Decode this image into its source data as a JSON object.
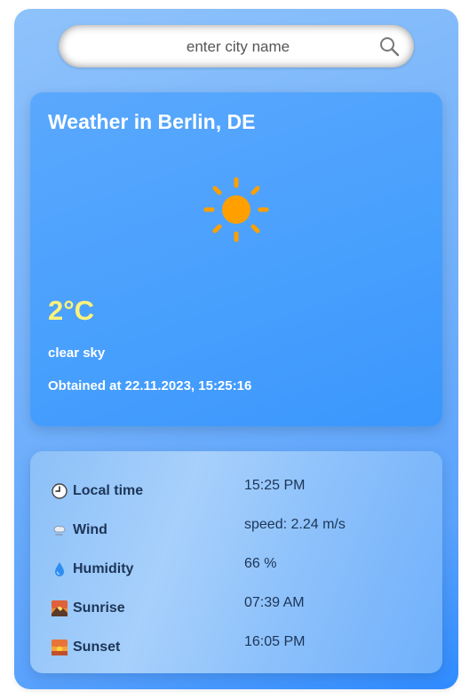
{
  "search": {
    "placeholder": "enter city name"
  },
  "weather": {
    "title": "Weather in Berlin, DE",
    "icon": "sun-icon",
    "temperature": "2°C",
    "description": "clear sky",
    "obtained": "Obtained at 22.11.2023, 15:25:16",
    "temp_color": "#fdf27a"
  },
  "details": [
    {
      "icon": "clock-icon",
      "label": "Local time",
      "value": "15:25 PM"
    },
    {
      "icon": "wind-icon",
      "label": "Wind",
      "value": "speed: 2.24 m/s"
    },
    {
      "icon": "droplet-icon",
      "label": "Humidity",
      "value": "66 %"
    },
    {
      "icon": "sunrise-icon",
      "label": "Sunrise",
      "value": "07:39 AM"
    },
    {
      "icon": "sunset-icon",
      "label": "Sunset",
      "value": "16:05 PM"
    }
  ]
}
